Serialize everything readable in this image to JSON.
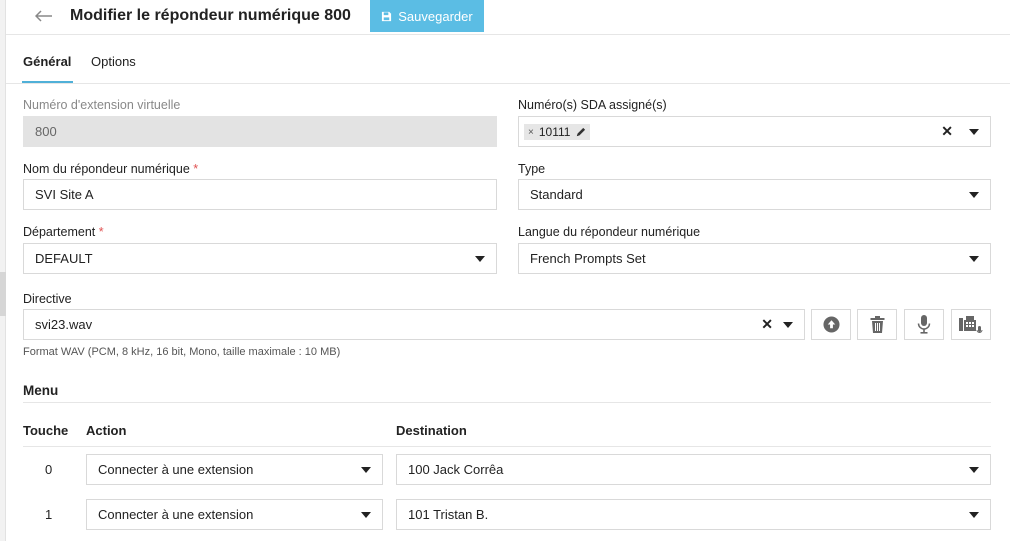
{
  "header": {
    "title": "Modifier le répondeur numérique 800",
    "save_label": "Sauvegarder"
  },
  "tabs": [
    {
      "label": "Général",
      "active": true
    },
    {
      "label": "Options",
      "active": false
    }
  ],
  "form": {
    "extension_label": "Numéro d'extension virtuelle",
    "extension_value": "800",
    "sda_label": "Numéro(s) SDA assigné(s)",
    "sda_chip": "10111",
    "name_label": "Nom du répondeur numérique",
    "name_value": "SVI Site A",
    "type_label": "Type",
    "type_value": "Standard",
    "department_label": "Département",
    "department_value": "DEFAULT",
    "language_label": "Langue du répondeur numérique",
    "language_value": "French Prompts Set",
    "directive_label": "Directive",
    "directive_value": "svi23.wav",
    "directive_hint": "Format WAV (PCM, 8 kHz, 16 bit, Mono, taille maximale : 10 MB)",
    "required_mark": "*"
  },
  "directive_actions": [
    {
      "name": "upload-icon"
    },
    {
      "name": "trash-icon"
    },
    {
      "name": "microphone-icon"
    },
    {
      "name": "phone-record-icon"
    }
  ],
  "menu": {
    "title": "Menu",
    "col_key": "Touche",
    "col_action": "Action",
    "col_destination": "Destination",
    "rows": [
      {
        "key": "0",
        "action": "Connecter à une extension",
        "destination": "100 Jack Corrêa"
      },
      {
        "key": "1",
        "action": "Connecter à une extension",
        "destination": "101 Tristan B."
      }
    ]
  },
  "colors": {
    "accent": "#5bbde4",
    "tab_underline": "#4fb0d8",
    "required": "#e05252"
  }
}
